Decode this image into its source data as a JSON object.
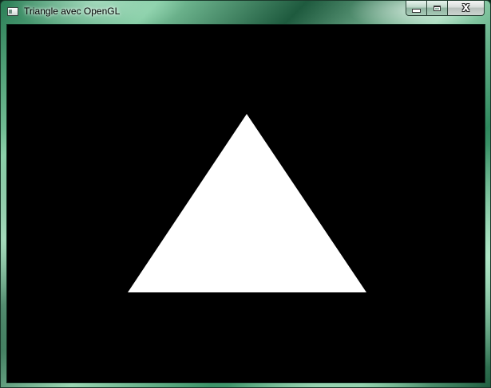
{
  "window": {
    "title": "Triangle avec OpenGL",
    "icon": "application-window-icon",
    "caption_buttons": [
      {
        "name": "minimize",
        "icon": "minimize-icon"
      },
      {
        "name": "maximize",
        "icon": "maximize-icon"
      },
      {
        "name": "close",
        "icon": "close-icon"
      }
    ]
  },
  "scene": {
    "background_color": "#000000",
    "shape": "triangle",
    "shape_color": "#ffffff"
  }
}
